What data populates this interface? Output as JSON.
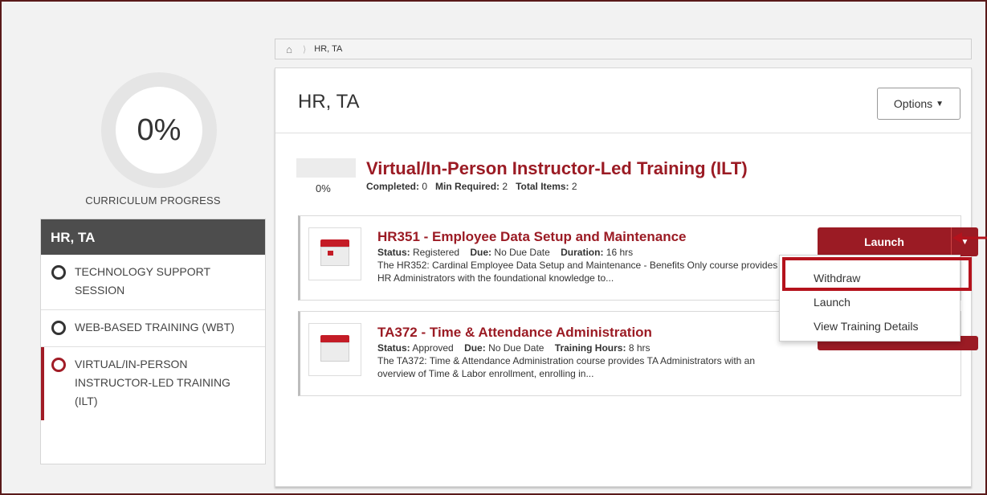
{
  "left": {
    "progress_pct": "0%",
    "progress_label": "CURRICULUM PROGRESS",
    "nav_header": "HR, TA",
    "nav_items": [
      {
        "label": "TECHNOLOGY SUPPORT SESSION"
      },
      {
        "label": "WEB-BASED TRAINING (WBT)"
      },
      {
        "label": "VIRTUAL/IN-PERSON INSTRUCTOR-LED TRAINING (ILT)"
      }
    ]
  },
  "breadcrumb": {
    "current": "HR, TA"
  },
  "main": {
    "title": "HR, TA",
    "options_label": "Options",
    "section": {
      "pct": "0%",
      "title": "Virtual/In-Person Instructor-Led Training (ILT)",
      "completed_label": "Completed:",
      "completed_value": "0",
      "min_label": "Min Required:",
      "min_value": "2",
      "total_label": "Total Items:",
      "total_value": "2"
    },
    "courses": [
      {
        "title": "HR351 - Employee Data Setup and Maintenance",
        "status_label": "Status:",
        "status": "Registered",
        "due_label": "Due:",
        "due": "No Due Date",
        "extra_label": "Duration:",
        "extra": "16 hrs",
        "desc": "The HR352: Cardinal Employee Data Setup and Maintenance - Benefits Only course provides HR Administrators with the foundational knowledge to...",
        "button": "Launch"
      },
      {
        "title": "TA372 - Time & Attendance Administration",
        "status_label": "Status:",
        "status": "Approved",
        "due_label": "Due:",
        "due": "No Due Date",
        "extra_label": "Training Hours:",
        "extra": "8 hrs",
        "desc": "The TA372: Time & Attendance Administration course provides TA Administrators with an overview of Time & Labor enrollment, enrolling in..."
      }
    ]
  },
  "dropdown": {
    "items": [
      "Withdraw",
      "Launch",
      "View Training Details"
    ]
  },
  "colors": {
    "accent": "#9b1b24",
    "highlight": "#b4121c"
  }
}
